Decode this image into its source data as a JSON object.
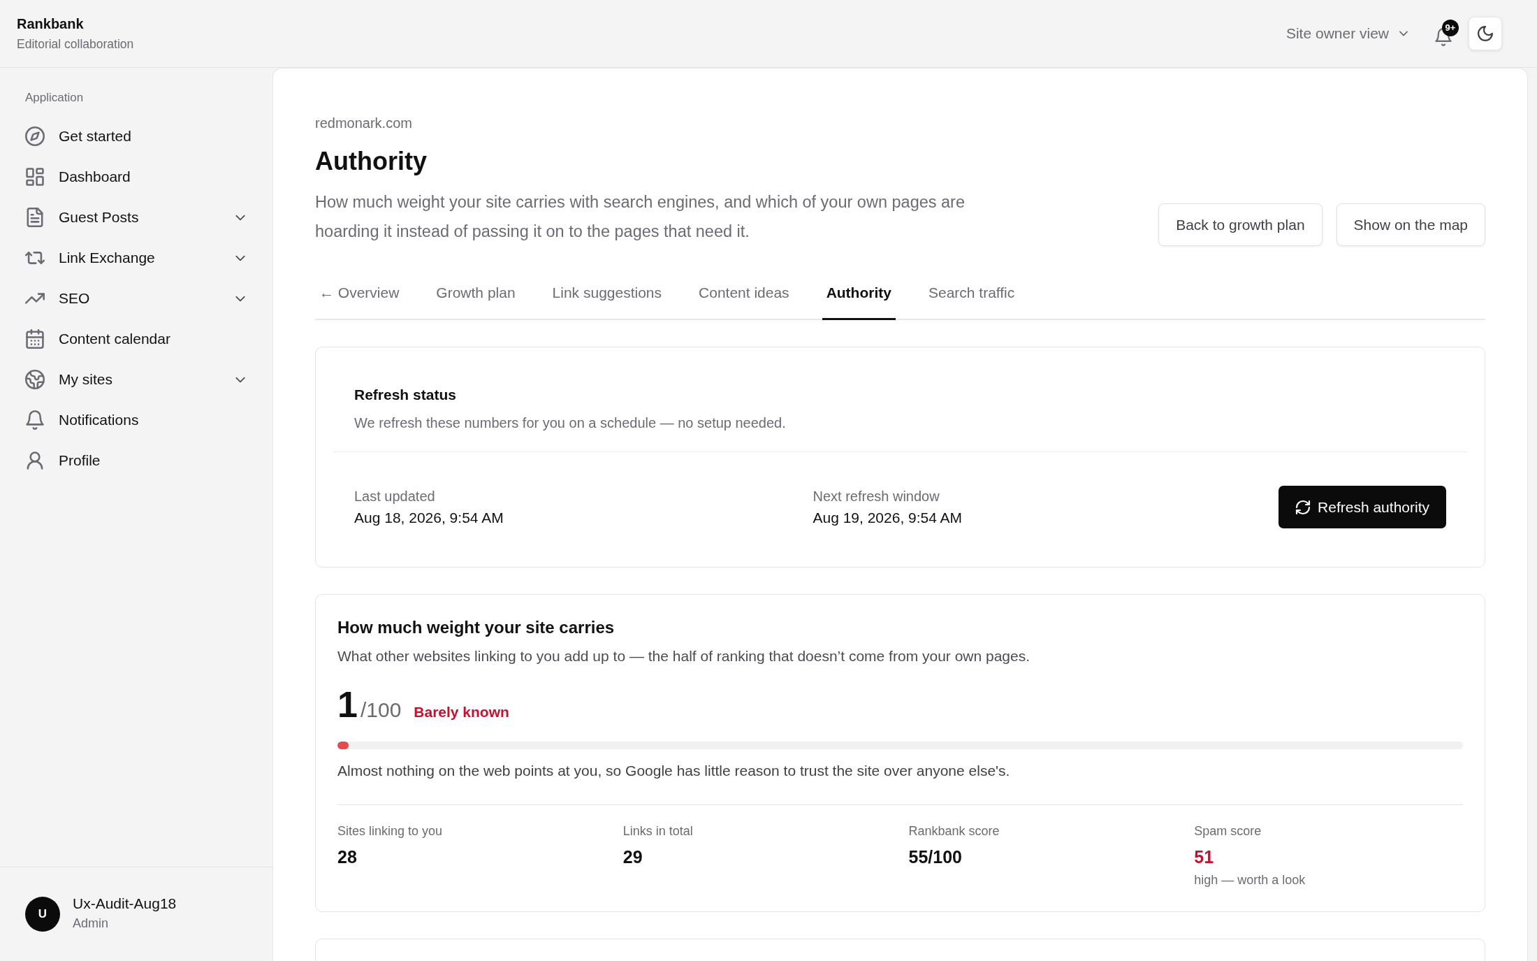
{
  "app": {
    "name": "Rankbank",
    "tagline": "Editorial collaboration"
  },
  "header": {
    "view_switcher": "Site owner view",
    "notification_badge": "9+"
  },
  "sidebar": {
    "section_label": "Application",
    "items": [
      {
        "label": "Get started",
        "has_submenu": false
      },
      {
        "label": "Dashboard",
        "has_submenu": false
      },
      {
        "label": "Guest Posts",
        "has_submenu": true
      },
      {
        "label": "Link Exchange",
        "has_submenu": true
      },
      {
        "label": "SEO",
        "has_submenu": true
      },
      {
        "label": "Content calendar",
        "has_submenu": false
      },
      {
        "label": "My sites",
        "has_submenu": true
      },
      {
        "label": "Notifications",
        "has_submenu": false
      },
      {
        "label": "Profile",
        "has_submenu": false
      }
    ],
    "user": {
      "initial": "U",
      "name": "Ux-Audit-Aug18",
      "role": "Admin"
    }
  },
  "page": {
    "site": "redmonark.com",
    "title": "Authority",
    "description": "How much weight your site carries with search engines, and which of your own pages are hoarding it instead of passing it on to the pages that need it.",
    "actions": [
      "Back to growth plan",
      "Show on the map"
    ]
  },
  "tabs": [
    {
      "label": "← Overview",
      "selected": false
    },
    {
      "label": "Growth plan",
      "selected": false
    },
    {
      "label": "Link suggestions",
      "selected": false
    },
    {
      "label": "Content ideas",
      "selected": false
    },
    {
      "label": "Authority",
      "selected": true
    },
    {
      "label": "Search traffic",
      "selected": false
    }
  ],
  "refresh_status": {
    "title": "Refresh status",
    "subtitle": "We refresh these numbers for you on a schedule — no setup needed.",
    "fields": [
      {
        "label": "Last updated",
        "value": "Aug 18, 2026, 9:54 AM"
      },
      {
        "label": "Next refresh window",
        "value": "Aug 19, 2026, 9:54 AM"
      }
    ],
    "button": "Refresh authority"
  },
  "site_weight": {
    "title": "How much weight your site carries",
    "subtitle": "What other websites linking to you add up to — the half of ranking that doesn’t come from your own pages.",
    "score": "1",
    "scale": "/100",
    "verdict": "Barely known",
    "level": 0.01,
    "explanation": "Almost nothing on the web points at you, so Google has little reason to trust the site over anyone else's.",
    "stats": [
      {
        "label": "Sites linking to you",
        "value": "28",
        "alert": false
      },
      {
        "label": "Links in total",
        "value": "29",
        "alert": false
      },
      {
        "label": "Rankbank score",
        "value": "55/100",
        "alert": false
      },
      {
        "label": "Spam score",
        "value": "51",
        "alert": true,
        "note": "high — worth a look"
      }
    ]
  }
}
